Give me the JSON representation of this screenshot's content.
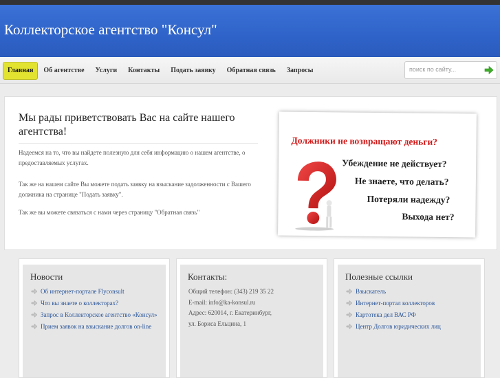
{
  "header": {
    "site_title": "Коллекторское агентство \"Консул\""
  },
  "nav": {
    "items": [
      {
        "label": "Главная",
        "active": true
      },
      {
        "label": "Об агентстве"
      },
      {
        "label": "Услуги"
      },
      {
        "label": "Контакты"
      },
      {
        "label": "Подать заявку"
      },
      {
        "label": "Обратная связь"
      },
      {
        "label": "Запросы"
      }
    ]
  },
  "search": {
    "placeholder": "поиск по сайту...",
    "button_icon": "arrow-right-icon"
  },
  "welcome": {
    "title": "Мы рады приветствовать Вас на сайте нашего агентства!",
    "paragraphs": [
      "Надеемся на то, что вы найдете полезную для себя информацию о нашем агентстве, о предоставляемых услугах.",
      "Так же на нашем сайте Вы можете подать заявку на взыскание задолженности с Вашего должника на странице \"Подать заявку\".",
      "Так же вы можете связаться с нами через страницу \"Обратная связь\""
    ]
  },
  "banner": {
    "title": "Должники не возвращают деньги?",
    "lines": [
      "Убеждение не действует?",
      "Не знаете, что делать?",
      "Потеряли надежду?",
      "Выхода нет?"
    ],
    "title_color": "#d01818"
  },
  "news": {
    "title": "Новости",
    "items": [
      "Об интернет-портале Flyconsult",
      "Что вы знаете о коллекторах?",
      "Запрос в Коллекторское агентство «Консул»",
      "Прием заявок на взыскание долгов on-line"
    ]
  },
  "contacts": {
    "title": "Контакты:",
    "lines": [
      "Общий телефон: (343) 219 35 22",
      "E-mail: info@ka-konsul.ru",
      "Адрес: 620014, г. Екатеринбург,",
      "ул. Бориса Ельцина, 1"
    ]
  },
  "links": {
    "title": "Полезные ссылки",
    "items": [
      "Взыскатель",
      "Интернет-портал коллекторов",
      "Картотека дел ВАС РФ",
      "Центр Долгов юридических лиц"
    ]
  },
  "colors": {
    "header_blue": "#2f63c9",
    "active_nav": "#e2e230",
    "link_blue": "#2a5599"
  }
}
